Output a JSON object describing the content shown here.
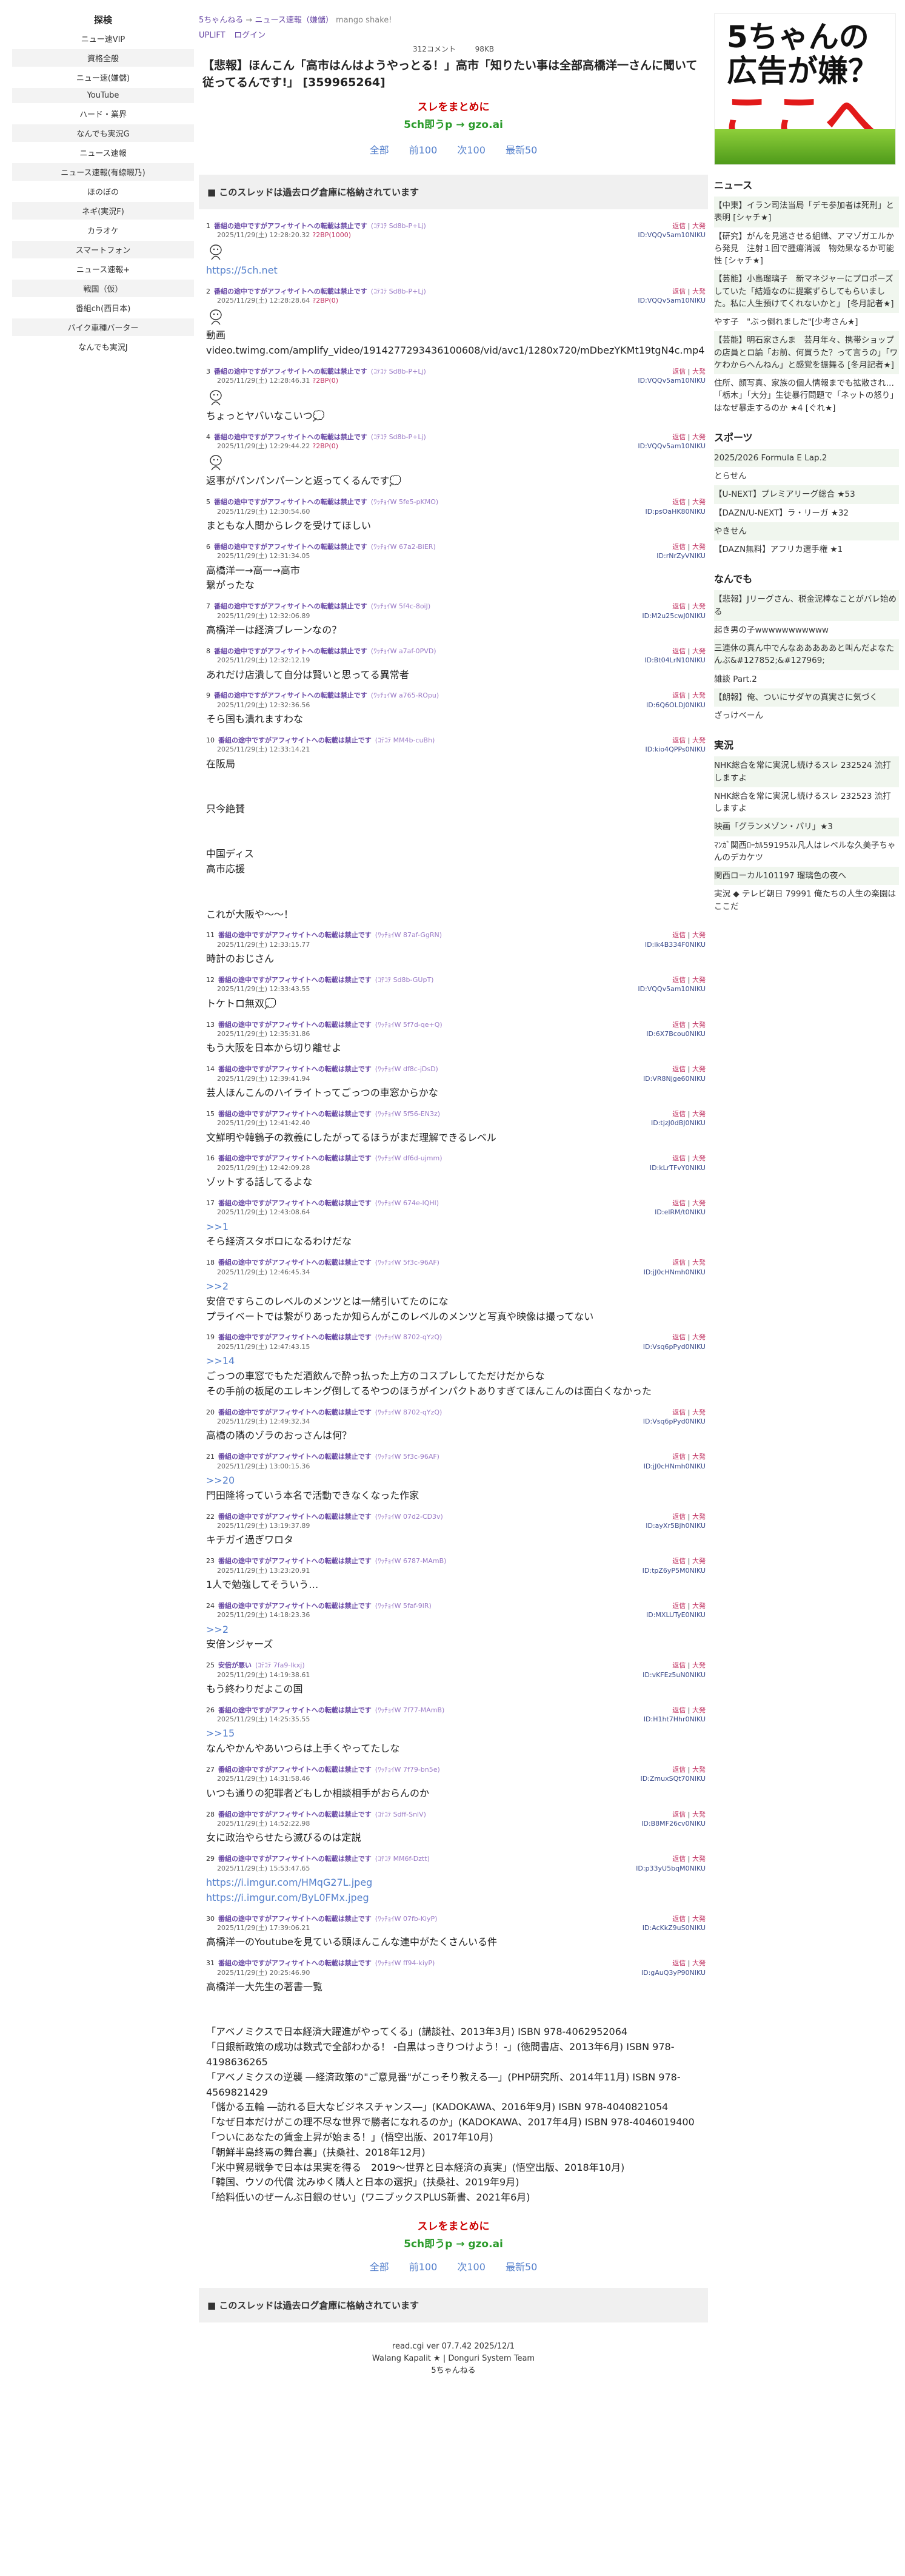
{
  "left": {
    "title": "探検",
    "items": [
      "ニュー速VIP",
      "資格全般",
      "ニュー速(嫌儲)",
      "YouTube",
      "ハード・業界",
      "なんでも実況G",
      "ニュース速報",
      "ニュース速報(有線暇乃)",
      "ほのぼの",
      "ネギ(実況F)",
      "カラオケ",
      "スマートフォン",
      "ニュース速報+",
      "戦国（仮）",
      "番組ch(西日本)",
      "バイク車種バーター",
      "なんでも実況J"
    ]
  },
  "crumbs": {
    "site": "5ちゃんねる",
    "arrow": "→",
    "board": "ニュース速報（嫌儲）",
    "extra": "mango shake!"
  },
  "toplinks": [
    "UPLIFT",
    "ログイン"
  ],
  "stats": {
    "comments": "312コメント",
    "size": "98KB"
  },
  "title": "【悲報】ほんこん「高市はんはようやっとる！」高市「知りたい事は全部高橋洋一さんに聞いて従ってるんです!」 [359965264]",
  "matome": {
    "line1": "スレをまとめに",
    "line2": "5ch即うp → gzo.ai"
  },
  "pager": [
    "全部",
    "前100",
    "次100",
    "最新50"
  ],
  "stopbar": "このスレッドは過去ログ倉庫に格納されています",
  "link_label": "返信",
  "link_big": "大発",
  "posts": [
    {
      "num": "1",
      "name": "番組の途中ですがアフィサイトへの転載は禁止です",
      "trip": "(ｺﾃｺﾃ Sd8b-P+Lj)",
      "date": "2025/11/29(土) 12:28:20.32",
      "be": "?2BP(1000)",
      "id": "ID:VQQv5am10NIKU",
      "ga": true,
      "msg": "https://5ch.net",
      "link": true
    },
    {
      "num": "2",
      "name": "番組の途中ですがアフィサイトへの転載は禁止です",
      "trip": "(ｺﾃｺﾃ Sd8b-P+Lj)",
      "date": "2025/11/29(土) 12:28:28.64",
      "be": "?2BP(0)",
      "id": "ID:VQQv5am10NIKU",
      "ga": true,
      "msg": "動画\nvideo.twimg.com/amplify_video/1914277293436100608/vid/avc1/1280x720/mDbezYKMt19tgN4c.mp4"
    },
    {
      "num": "3",
      "name": "番組の途中ですがアフィサイトへの転載は禁止です",
      "trip": "(ｺﾃｺﾃ Sd8b-P+Lj)",
      "date": "2025/11/29(土) 12:28:46.31",
      "be": "?2BP(0)",
      "id": "ID:VQQv5am10NIKU",
      "ga": true,
      "msg": "ちょっとヤバいなこいつ💭"
    },
    {
      "num": "4",
      "name": "番組の途中ですがアフィサイトへの転載は禁止です",
      "trip": "(ｺﾃｺﾃ Sd8b-P+Lj)",
      "date": "2025/11/29(土) 12:29:44.22",
      "be": "?2BP(0)",
      "id": "ID:VQQv5am10NIKU",
      "ga": true,
      "msg": "返事がパンパンパーンと返ってくるんです💭"
    },
    {
      "num": "5",
      "name": "番組の途中ですがアフィサイトへの転載は禁止です",
      "trip": "(ﾜｯﾁｮｲW 5fe5-pKMO)",
      "date": "2025/11/29(土) 12:30:54.60",
      "id": "ID:psOaHK80NIKU",
      "msg": "まともな人間からレクを受けてほしい"
    },
    {
      "num": "6",
      "name": "番組の途中ですがアフィサイトへの転載は禁止です",
      "trip": "(ﾜｯﾁｮｲW 67a2-BiER)",
      "date": "2025/11/29(土) 12:31:34.05",
      "id": "ID:rNrZyVNIKU",
      "msg": "高橋洋一→高一→高市\n繋がったな"
    },
    {
      "num": "7",
      "name": "番組の途中ですがアフィサイトへの転載は禁止です",
      "trip": "(ﾜｯﾁｮｲW 5f4c-8oiJ)",
      "date": "2025/11/29(土) 12:32:06.89",
      "id": "ID:M2u25cwJ0NIKU",
      "msg": "高橋洋一は経済ブレーンなの？"
    },
    {
      "num": "8",
      "name": "番組の途中ですがアフィサイトへの転載は禁止です",
      "trip": "(ﾜｯﾁｮｲW a7af-0PVD)",
      "date": "2025/11/29(土) 12:32:12.19",
      "id": "ID:Bt04LrN10NIKU",
      "msg": "あれだけ店潰して自分は賢いと思ってる異常者"
    },
    {
      "num": "9",
      "name": "番組の途中ですがアフィサイトへの転載は禁止です",
      "trip": "(ﾜｯﾁｮｲW a765-ROpu)",
      "date": "2025/11/29(土) 12:32:36.56",
      "id": "ID:6Q6OLDJ0NIKU",
      "msg": "そら国も潰れますわな"
    },
    {
      "num": "10",
      "name": "番組の途中ですがアフィサイトへの転載は禁止です",
      "trip": "(ｺﾃｺﾃ MM4b-cuBh)",
      "date": "2025/11/29(土) 12:33:14.21",
      "id": "ID:kio4QPPs0NIKU",
      "msg": "在阪局\n\n\n只今絶賛\n\n\n中国ディス\n高市応援\n\n\nこれが大阪や～～！"
    },
    {
      "num": "11",
      "name": "番組の途中ですがアフィサイトへの転載は禁止です",
      "trip": "(ﾜｯﾁｮｲW 87af-GgRN)",
      "date": "2025/11/29(土) 12:33:15.77",
      "id": "ID:ik4B334F0NIKU",
      "msg": "時計のおじさん"
    },
    {
      "num": "12",
      "name": "番組の途中ですがアフィサイトへの転載は禁止です",
      "trip": "(ｺﾃｺﾃ Sd8b-GUpT)",
      "date": "2025/11/29(土) 12:33:43.55",
      "id": "ID:VQQv5am10NIKU",
      "msg": "トケトロ無双💭"
    },
    {
      "num": "13",
      "name": "番組の途中ですがアフィサイトへの転載は禁止です",
      "trip": "(ﾜｯﾁｮｲW 5f7d-qe+Q)",
      "date": "2025/11/29(土) 12:35:31.86",
      "id": "ID:6X7Bcou0NIKU",
      "msg": "もう大阪を日本から切り離せよ"
    },
    {
      "num": "14",
      "name": "番組の途中ですがアフィサイトへの転載は禁止です",
      "trip": "(ﾜｯﾁｮｲW df8c-jDsD)",
      "date": "2025/11/29(土) 12:39:41.94",
      "id": "ID:VR8Njge60NIKU",
      "msg": "芸人ほんこんのハイライトってごっつの車窓からかな"
    },
    {
      "num": "15",
      "name": "番組の途中ですがアフィサイトへの転載は禁止です",
      "trip": "(ﾜｯﾁｮｲW 5f56-EN3z)",
      "date": "2025/11/29(土) 12:41:42.40",
      "id": "ID:tjzJ0dBJ0NIKU",
      "msg": "文鮮明や韓鶴子の教義にしたがってるほうがまだ理解できるレベル"
    },
    {
      "num": "16",
      "name": "番組の途中ですがアフィサイトへの転載は禁止です",
      "trip": "(ﾜｯﾁｮｲW df6d-ujmm)",
      "date": "2025/11/29(土) 12:42:09.28",
      "id": "ID:kLrTFvY0NIKU",
      "msg": "ゾットする話してるよな"
    },
    {
      "num": "17",
      "name": "番組の途中ですがアフィサイトへの転載は禁止です",
      "trip": "(ﾜｯﾁｮｲW 674e-lQHl)",
      "date": "2025/11/29(土) 12:43:08.64",
      "id": "ID:elRM/t0NIKU",
      "anc": ">>1",
      "msg": "そら経済スタボロになるわけだな"
    },
    {
      "num": "18",
      "name": "番組の途中ですがアフィサイトへの転載は禁止です",
      "trip": "(ﾜｯﾁｮｲW 5f3c-96AF)",
      "date": "2025/11/29(土) 12:46:45.34",
      "id": "ID:jJ0cHNmh0NIKU",
      "anc": ">>2",
      "msg": "安倍ですらこのレベルのメンツとは一緒引いてたのにな\nプライベートでは繋がりあったか知らんがこのレベルのメンツと写真や映像は撮ってない"
    },
    {
      "num": "19",
      "name": "番組の途中ですがアフィサイトへの転載は禁止です",
      "trip": "(ﾜｯﾁｮｲW 8702-qYzQ)",
      "date": "2025/11/29(土) 12:47:43.15",
      "id": "ID:Vsq6pPyd0NIKU",
      "anc": ">>14",
      "msg": "ごっつの車窓でもただ酒飲んで酔っ払った上方のコスプレしてただけだからな\nその手前の板尾のエレキング倒してるやつのほうがインパクトありすぎてほんこんのは面白くなかった"
    },
    {
      "num": "20",
      "name": "番組の途中ですがアフィサイトへの転載は禁止です",
      "trip": "(ﾜｯﾁｮｲW 8702-qYzQ)",
      "date": "2025/11/29(土) 12:49:32.34",
      "id": "ID:Vsq6pPyd0NIKU",
      "msg": "高橋の隣のゾラのおっさんは何？"
    },
    {
      "num": "21",
      "name": "番組の途中ですがアフィサイトへの転載は禁止です",
      "trip": "(ﾜｯﾁｮｲW 5f3c-96AF)",
      "date": "2025/11/29(土) 13:00:15.36",
      "id": "ID:jJ0cHNmh0NIKU",
      "anc": ">>20",
      "msg": "門田隆将っていう本名で活動できなくなった作家"
    },
    {
      "num": "22",
      "name": "番組の途中ですがアフィサイトへの転載は禁止です",
      "trip": "(ﾜｯﾁｮｲW 07d2-CD3v)",
      "date": "2025/11/29(土) 13:19:37.89",
      "id": "ID:ayXr5Bjh0NIKU",
      "msg": "キチガイ過ぎワロタ"
    },
    {
      "num": "23",
      "name": "番組の途中ですがアフィサイトへの転載は禁止です",
      "trip": "(ﾜｯﾁｮｲW 6787-MAmB)",
      "date": "2025/11/29(土) 13:23:20.91",
      "id": "ID:tpZ6yP5M0NIKU",
      "msg": "1人で勉強してそういう…"
    },
    {
      "num": "24",
      "name": "番組の途中ですがアフィサイトへの転載は禁止です",
      "trip": "(ﾜｯﾁｮｲW 5faf-9lR)",
      "date": "2025/11/29(土) 14:18:23.36",
      "id": "ID:MXLUTyE0NIKU",
      "anc": ">>2",
      "msg": "安倍ンジャーズ"
    },
    {
      "num": "25",
      "name": "安倍が悪い",
      "trip": "(ｺﾃｺﾃ 7fa9-lkxj)",
      "date": "2025/11/29(土) 14:19:38.61",
      "id": "ID:vKFEz5uN0NIKU",
      "msg": "もう終わりだよこの国"
    },
    {
      "num": "26",
      "name": "番組の途中ですがアフィサイトへの転載は禁止です",
      "trip": "(ﾜｯﾁｮｲW 7f77-MAmB)",
      "date": "2025/11/29(土) 14:25:35.55",
      "id": "ID:H1ht7Hhr0NIKU",
      "anc": ">>15",
      "msg": "なんやかんやあいつらは上手くやってたしな"
    },
    {
      "num": "27",
      "name": "番組の途中ですがアフィサイトへの転載は禁止です",
      "trip": "(ﾜｯﾁｮｲW 7f79-bn5e)",
      "date": "2025/11/29(土) 14:31:58.46",
      "id": "ID:ZmuxSQt70NIKU",
      "msg": "いつも通りの犯罪者どもしか相談相手がおらんのか"
    },
    {
      "num": "28",
      "name": "番組の途中ですがアフィサイトへの転載は禁止です",
      "trip": "(ｺﾃｺﾃ Sdff-SnlV)",
      "date": "2025/11/29(土) 14:52:22.98",
      "id": "ID:B8MF26cv0NIKU",
      "msg": "女に政治やらせたら滅びるのは定説"
    },
    {
      "num": "29",
      "name": "番組の途中ですがアフィサイトへの転載は禁止です",
      "trip": "(ｺﾃｺﾃ MM6f-Dztt)",
      "date": "2025/11/29(土) 15:53:47.65",
      "id": "ID:p33yU5bqM0NIKU",
      "msg": "https://i.imgur.com/HMqG27L.jpeg\nhttps://i.imgur.com/ByL0FMx.jpeg",
      "link": true
    },
    {
      "num": "30",
      "name": "番組の途中ですがアフィサイトへの転載は禁止です",
      "trip": "(ﾜｯﾁｮｲW 07fb-KiyP)",
      "date": "2025/11/29(土) 17:39:06.21",
      "id": "ID:AcKkZ9uS0NIKU",
      "msg": "高橋洋一のYoutubeを見ている頭ほんこんな連中がたくさんいる件"
    },
    {
      "num": "31",
      "name": "番組の途中ですがアフィサイトへの転載は禁止です",
      "trip": "(ﾜｯﾁｮｲW ff94-kiyP)",
      "date": "2025/11/29(土) 20:25:46.90",
      "id": "ID:gAuQ3yP90NIKU",
      "msg": "高橋洋一大先生の著書一覧\n\n\n「アベノミクスで日本経済大躍進がやってくる」(講談社、2013年3月) ISBN 978-4062952064\n「日銀新政策の成功は数式で全部わかる！ -白黒はっきりつけよう！-」(徳間書店、2013年6月) ISBN 978-4198636265\n「アベノミクスの逆襲 ―経済政策の\"ご意見番\"がこっそり教える―」(PHP研究所、2014年11月) ISBN 978-4569821429\n「儲かる五輪 ―訪れる巨大なビジネスチャンス―」(KADOKAWA、2016年9月) ISBN 978-4040821054\n「なぜ日本だけがこの理不尽な世界で勝者になれるのか」(KADOKAWA、2017年4月) ISBN 978-4046019400\n「ついにあなたの賃金上昇が始まる！」(悟空出版、2017年10月)\n「朝鮮半島終焉の舞台裏」(扶桑社、2018年12月)\n「米中貿易戦争で日本は果実を得る　2019～世界と日本経済の真実」(悟空出版、2018年10月)\n「韓国、ウソの代償 沈みゆく隣人と日本の選択」(扶桑社、2019年9月)\n「給料低いのぜーんぶ日銀のせい」(ワニブックスPLUS新書、2021年6月)"
    }
  ],
  "footer": [
    "read.cgi ver 07.7.42 2025/12/1",
    "Walang Kapalit ★ | Donguri System Team",
    "5ちゃんねる"
  ],
  "ad": {
    "line1": "5ちゃんの",
    "line2": "広告が嫌？",
    "line3": "ここへ"
  },
  "right": {
    "news_title": "ニュース",
    "news": [
      "【中東】イラン司法当局「デモ参加者は死刑」と表明 [シャチ★]",
      "【研究】がんを見逃させる組織、アマゾガエルから発見　注射１回で腫瘍消滅　物効果なるか可能性 [シャチ★]",
      "【芸能】小島瑠璃子　新マネジャーにプロポーズしていた「結婚なのに提案ずらしてもらいました。私に人生預けてくれないかと」 [冬月記者★]",
      "やす子　\"ぶっ倒れました\"[少考さん★]",
      "【芸能】明石家さんま　芸月年々、携帯ショップの店員とロ論「お前、何買うた？って言うの」「ワケわからへんねん」と感覚を振舞る [冬月記者★]",
      "住所、顔写真、家族の個人情報までも拡散され…「栃木」「大分」生徒暴行問題で「ネットの怒り」はなぜ暴走するのか ★4 [ぐれ★]"
    ],
    "sports_title": "スポーツ",
    "sports": [
      "2025/2026 Formula E Lap.2",
      "とらせん",
      "【U-NEXT】プレミアリーグ総合 ★53",
      "【DAZN/U-NEXT】ラ・リーガ ★32",
      "やきせん",
      "【DAZN無料】アフリカ選手権 ★1"
    ],
    "nandemo_title": "なんでも",
    "nandemo": [
      "【悲報】Jリーグさん、税金泥棒なことがバレ始める",
      "起き男の子wwwwwwwwwww",
      "三連休の真ん中でんなあああああと叫んだよなたんぶ&#127852;&#127969;",
      "雑談 Part.2",
      "【朗報】俺、ついにサダヤの真実さに気づく",
      "ざっけべーん"
    ],
    "live_title": "実況",
    "live": [
      "NHK総合を常に実況し続けるスレ 232524 流打しますよ",
      "NHK総合を常に実況し続けるスレ 232523 流打しますよ",
      "映画「グランメゾン・パリ」★3",
      "ﾏﾝｶﾞ関西ﾛｰｶﾙ59195ｽﾚ凡人はレベルな久美子ちゃんのデカケツ",
      "関西ローカル101197 瑠璃色の夜へ",
      "実況 ◆ テレビ朝日 79991 俺たちの人生の楽園はここだ"
    ]
  }
}
